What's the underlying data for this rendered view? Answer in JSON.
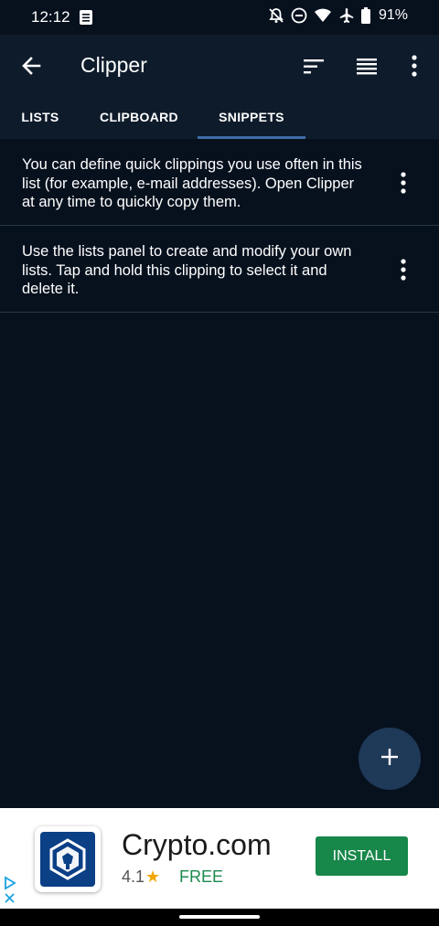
{
  "status_bar": {
    "time": "12:12",
    "battery_percent": "91%",
    "icons": [
      "clipboard-note-icon",
      "bell-off-icon",
      "do-not-disturb-icon",
      "wifi-icon",
      "airplane-icon",
      "battery-icon"
    ]
  },
  "app_bar": {
    "title": "Clipper",
    "icons": [
      "back-arrow-icon",
      "sort-icon",
      "view-list-icon",
      "more-vert-icon"
    ]
  },
  "tabs": [
    {
      "label": "LISTS"
    },
    {
      "label": "CLIPBOARD"
    },
    {
      "label": "SNIPPETS",
      "selected": true
    }
  ],
  "snippets": [
    {
      "text": "You can define quick clippings you use often in this list (for example, e-mail addresses). Open Clipper at any time to quickly copy them."
    },
    {
      "text": "Use the lists panel to create and modify your own lists. Tap and hold this clipping to select it and delete it."
    }
  ],
  "fab": {
    "icon": "plus-icon"
  },
  "ad": {
    "title": "Crypto.com",
    "rating": "4.1",
    "price": "FREE",
    "install_label": "INSTALL"
  },
  "colors": {
    "background": "#07111e",
    "app_bar": "#0e1b2b",
    "tab_indicator": "#3e6ea6",
    "fab": "#1f3958",
    "install_button": "#17874a"
  }
}
